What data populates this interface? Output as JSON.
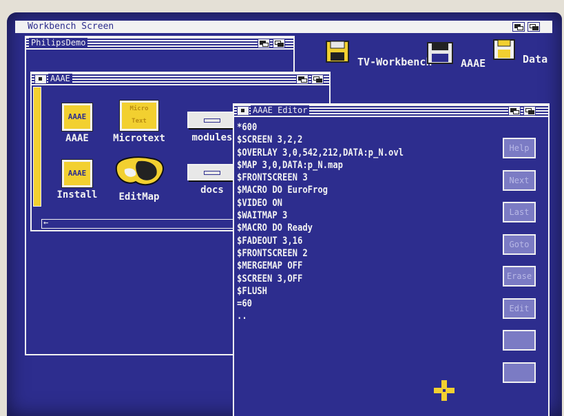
{
  "screen": {
    "title": "Workbench Screen"
  },
  "desktop_icons": [
    {
      "label": "TV-Workbench"
    },
    {
      "label": "AAAE"
    },
    {
      "label": "Data"
    }
  ],
  "philips_window": {
    "title": "PhilipsDemo"
  },
  "aaae_window": {
    "title": "AAAE",
    "icons": [
      {
        "label": "AAAE",
        "badge": "AAAE"
      },
      {
        "label": "Microtext",
        "badge": "Micro Text"
      },
      {
        "label": "modules"
      },
      {
        "label": "Install",
        "badge": "AAAE"
      },
      {
        "label": "EditMap"
      },
      {
        "label": "docs"
      }
    ]
  },
  "editor": {
    "title": "AAAE Editor",
    "lines": [
      "*600",
      "$SCREEN 3,2,2",
      "$OVERLAY 3,0,542,212,DATA:p_N.ovl",
      "$MAP 3,0,DATA:p_N.map",
      "$FRONTSCREEN 3",
      "$MACRO DO EuroFrog",
      "$VIDEO ON",
      "$WAITMAP 3",
      "$MACRO DO Ready",
      "$FADEOUT 3,16",
      "$FRONTSCREEN 2",
      "$MERGEMAP OFF",
      "$SCREEN 3,OFF",
      "$FLUSH",
      "=60",
      ".."
    ],
    "buttons": [
      "Help",
      "Next",
      "Last",
      "Goto",
      "Erase",
      "Edit",
      "",
      ""
    ]
  },
  "colors": {
    "screen": "#2d2d8e",
    "white": "#f2f2f2",
    "yellow": "#f2d030",
    "button": "#7b7bc4"
  }
}
